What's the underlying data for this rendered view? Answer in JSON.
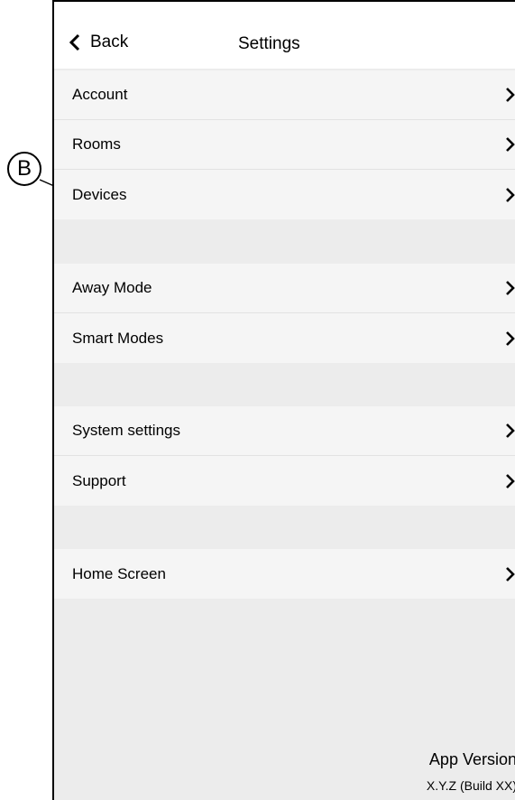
{
  "header": {
    "back_label": "Back",
    "title": "Settings"
  },
  "groups": [
    {
      "items": [
        "Account",
        "Rooms",
        "Devices"
      ]
    },
    {
      "items": [
        "Away Mode",
        "Smart Modes"
      ]
    },
    {
      "items": [
        "System settings",
        "Support"
      ]
    },
    {
      "items": [
        "Home Screen"
      ]
    }
  ],
  "footer": {
    "version_label": "App Version",
    "version_value": "X.Y.Z (Build XX)"
  },
  "callout": {
    "label": "B"
  }
}
